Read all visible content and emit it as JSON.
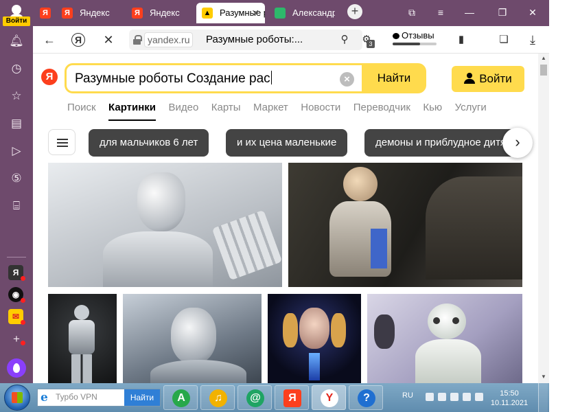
{
  "sidebar": {
    "login_label": "Войти",
    "apps": [
      {
        "name": "yandex-app",
        "glyph": "Я"
      },
      {
        "name": "alice-station-app",
        "glyph": "O"
      },
      {
        "name": "mail-app",
        "glyph": "M"
      }
    ]
  },
  "tabs": [
    {
      "label": "Яндекс",
      "active": false
    },
    {
      "label": "Яндекс",
      "active": false
    },
    {
      "label": "Разумные роботы",
      "active": true
    },
    {
      "label": "Александр",
      "active": false
    }
  ],
  "addressbar": {
    "domain": "yandex.ru",
    "title": "Разумные роботы:...",
    "reviews_label": "Отзывы",
    "badge_count": "3"
  },
  "search": {
    "logo": "Я",
    "query": "Разумные роботы Создание рас",
    "find_label": "Найти",
    "login_label": "Войти"
  },
  "services": [
    "Поиск",
    "Картинки",
    "Видео",
    "Карты",
    "Маркет",
    "Новости",
    "Переводчик",
    "Кью",
    "Услуги"
  ],
  "active_service": "Картинки",
  "chips": [
    "для мальчиков 6 лет",
    "и их цена маленькие",
    "демоны и приблудное дитя"
  ],
  "taskbar": {
    "vpn_placeholder": "Турбо VPN",
    "vpn_button": "Найти",
    "lang": "RU",
    "time": "15:50",
    "date": "10.11.2021"
  },
  "colors": {
    "accent_yellow": "#ffdb4d",
    "yandex_red": "#fc3f1d",
    "sidebar_purple": "#6e4a6c"
  }
}
